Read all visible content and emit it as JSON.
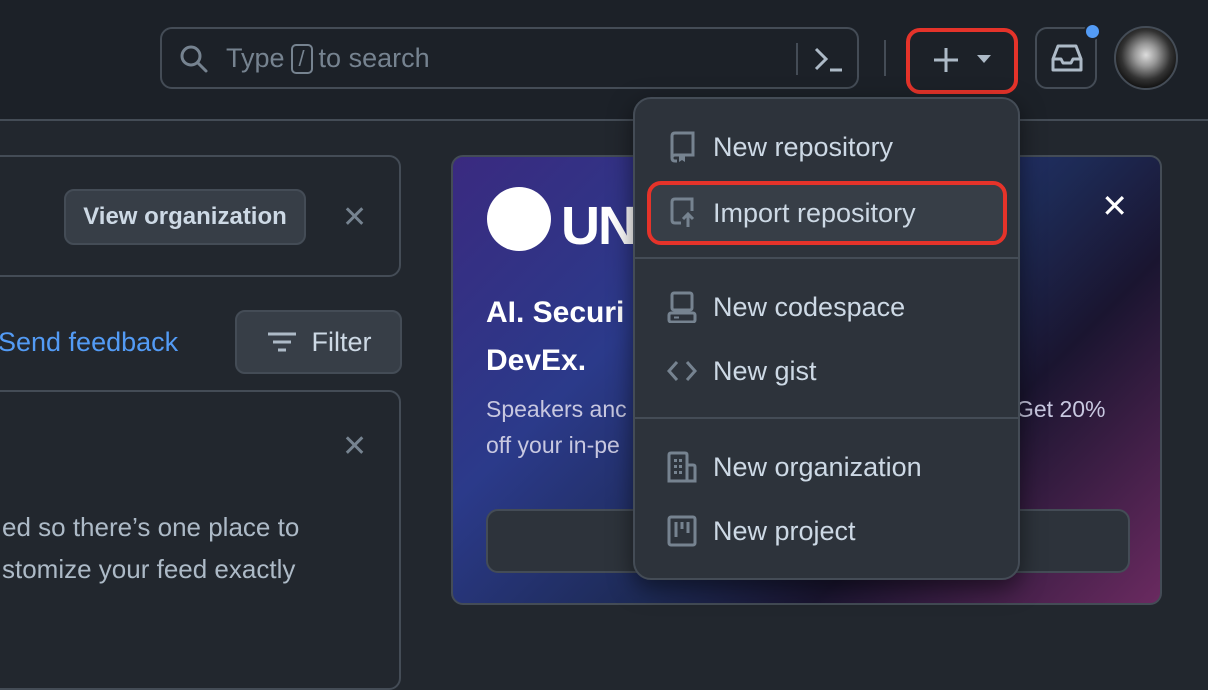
{
  "header": {
    "search": {
      "placeholder_before": "Type",
      "shortcut_key": "/",
      "placeholder_after": "to search"
    },
    "create_button_icon": "plus-icon",
    "notification_dot_color": "#539bf5"
  },
  "org_banner": {
    "view_organization_label": "View organization"
  },
  "feed_controls": {
    "send_feedback_label": "Send feedback",
    "filter_label": "Filter"
  },
  "feed_notice": {
    "line1": "ed so there’s one place to",
    "line2": "stomize your feed exactly"
  },
  "promo": {
    "brand_text": "UNI",
    "headline": "AI. Securi",
    "headline2": "DevEx.",
    "body_line1_left": "Speakers anc",
    "body_line1_right": "Get 20%",
    "body_line2": "off your in-pe"
  },
  "create_menu": {
    "items": [
      {
        "label": "New repository",
        "icon": "repo-icon"
      },
      {
        "label": "Import repository",
        "icon": "repo-push-icon",
        "highlighted": true
      },
      {
        "label": "New codespace",
        "icon": "codespaces-icon"
      },
      {
        "label": "New gist",
        "icon": "code-icon"
      },
      {
        "label": "New organization",
        "icon": "organization-icon"
      },
      {
        "label": "New project",
        "icon": "project-icon"
      }
    ]
  },
  "colors": {
    "highlight_outline": "#e5332a",
    "link": "#539bf5"
  }
}
